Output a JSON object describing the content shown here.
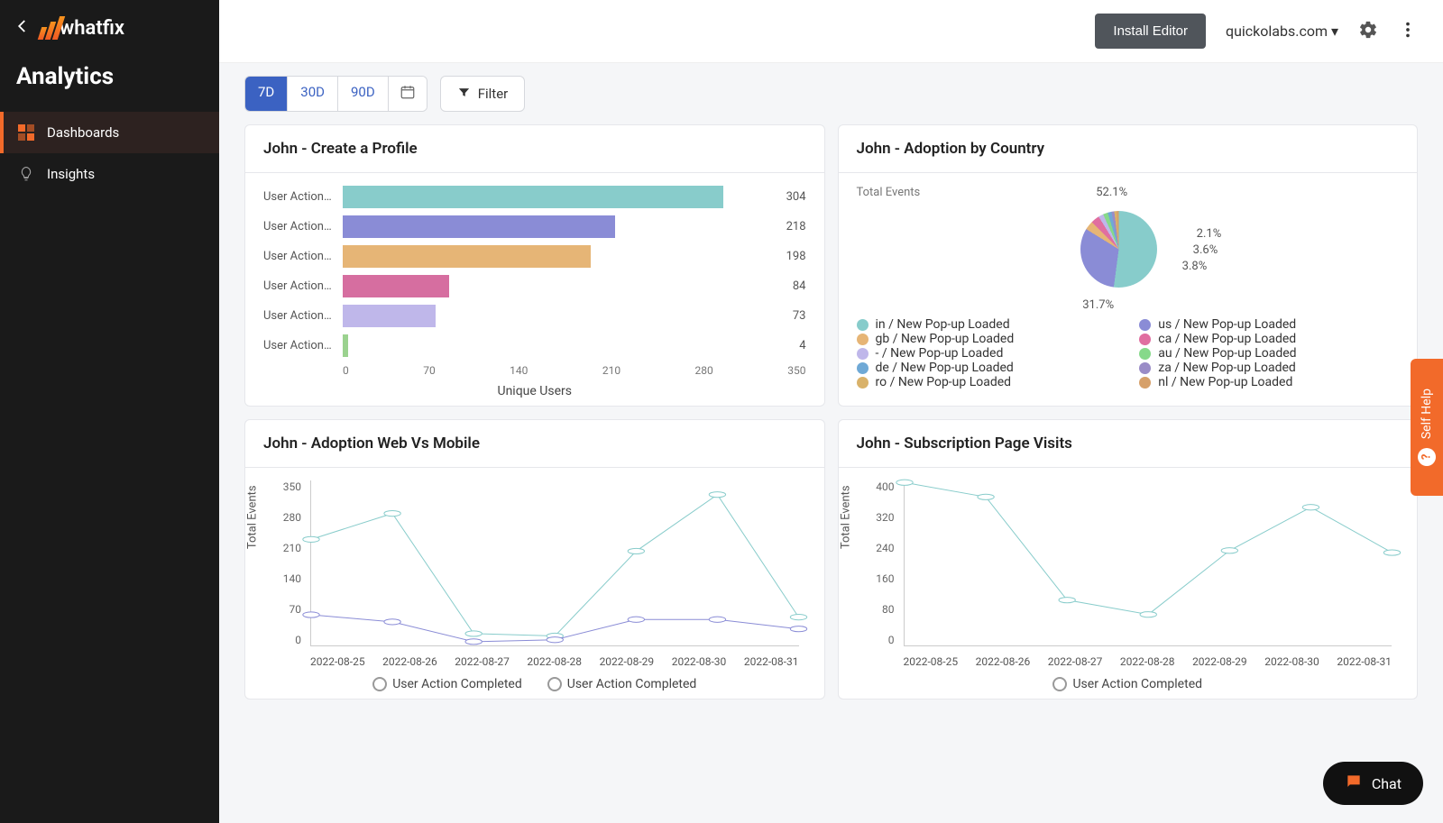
{
  "brand": "whatfix",
  "page_title": "Analytics",
  "sidebar": {
    "items": [
      {
        "label": "Dashboards",
        "active": true
      },
      {
        "label": "Insights",
        "active": false
      }
    ]
  },
  "topbar": {
    "install_label": "Install Editor",
    "domain": "quickolabs.com"
  },
  "toolbar": {
    "ranges": [
      "7D",
      "30D",
      "90D"
    ],
    "active_range": "7D",
    "filter_label": "Filter"
  },
  "cards": {
    "bar": {
      "title": "John - Create a Profile",
      "axis_label": "Unique Users"
    },
    "pie": {
      "title": "John - Adoption by Country",
      "side_label": "Total Events"
    },
    "line1": {
      "title": "John - Adoption Web Vs Mobile",
      "y_label": "Total Events",
      "legend": [
        "User Action Completed",
        "User Action Completed"
      ]
    },
    "line2": {
      "title": "John - Subscription Page Visits",
      "y_label": "Total Events",
      "legend": [
        "User Action Completed"
      ]
    }
  },
  "self_help_label": "Self Help",
  "chat_label": "Chat",
  "chart_data": [
    {
      "type": "bar",
      "orientation": "horizontal",
      "title": "John - Create a Profile",
      "xlabel": "Unique Users",
      "xticks": [
        0,
        70,
        140,
        210,
        280,
        350
      ],
      "categories": [
        "User Action…",
        "User Action…",
        "User Action…",
        "User Action…",
        "User Action…",
        "User Action…"
      ],
      "values": [
        304,
        218,
        198,
        84,
        73,
        4
      ],
      "colors": [
        "#88cccb",
        "#8a8cd6",
        "#e6b576",
        "#d66ea0",
        "#bfb7ea",
        "#9bd28f"
      ],
      "xlim": [
        0,
        350
      ]
    },
    {
      "type": "pie",
      "title": "John - Adoption by Country",
      "labels_shown": [
        "52.1%",
        "31.7%",
        "3.8%",
        "3.6%",
        "2.1%"
      ],
      "series": [
        {
          "name": "in / New Pop-up Loaded",
          "value": 52.1,
          "color": "#87cccb"
        },
        {
          "name": "us / New Pop-up Loaded",
          "value": 31.7,
          "color": "#8a8cd6"
        },
        {
          "name": "gb / New Pop-up Loaded",
          "value": 3.8,
          "color": "#e6b576"
        },
        {
          "name": "ca / New Pop-up Loaded",
          "value": 3.6,
          "color": "#e06ea0"
        },
        {
          "name": "- / New Pop-up Loaded",
          "value": 2.1,
          "color": "#bfb7ea"
        },
        {
          "name": "au / New Pop-up Loaded",
          "value": 2.0,
          "color": "#86d98a"
        },
        {
          "name": "de / New Pop-up Loaded",
          "value": 1.6,
          "color": "#6fa9d6"
        },
        {
          "name": "za / New Pop-up Loaded",
          "value": 1.2,
          "color": "#9a8cc7"
        },
        {
          "name": "ro / New Pop-up Loaded",
          "value": 1.0,
          "color": "#d9b26a"
        },
        {
          "name": "nl / New Pop-up Loaded",
          "value": 0.9,
          "color": "#d6a06a"
        }
      ]
    },
    {
      "type": "line",
      "title": "John - Adoption Web Vs Mobile",
      "ylabel": "Total Events",
      "ylim": [
        0,
        350
      ],
      "yticks": [
        0,
        70,
        140,
        210,
        280,
        350
      ],
      "x": [
        "2022-08-25",
        "2022-08-26",
        "2022-08-27",
        "2022-08-28",
        "2022-08-29",
        "2022-08-30",
        "2022-08-31"
      ],
      "series": [
        {
          "name": "User Action Completed",
          "color": "#88cccb",
          "values": [
            225,
            280,
            25,
            20,
            200,
            320,
            60
          ]
        },
        {
          "name": "User Action Completed",
          "color": "#8a8cd6",
          "values": [
            65,
            50,
            8,
            12,
            55,
            55,
            35
          ]
        }
      ]
    },
    {
      "type": "line",
      "title": "John - Subscription Page Visits",
      "ylabel": "Total Events",
      "ylim": [
        0,
        400
      ],
      "yticks": [
        0,
        80,
        160,
        240,
        320,
        400
      ],
      "x": [
        "2022-08-25",
        "2022-08-26",
        "2022-08-27",
        "2022-08-28",
        "2022-08-29",
        "2022-08-30",
        "2022-08-31"
      ],
      "series": [
        {
          "name": "User Action Completed",
          "color": "#88cccb",
          "values": [
            395,
            360,
            110,
            75,
            230,
            335,
            225
          ]
        }
      ]
    }
  ]
}
